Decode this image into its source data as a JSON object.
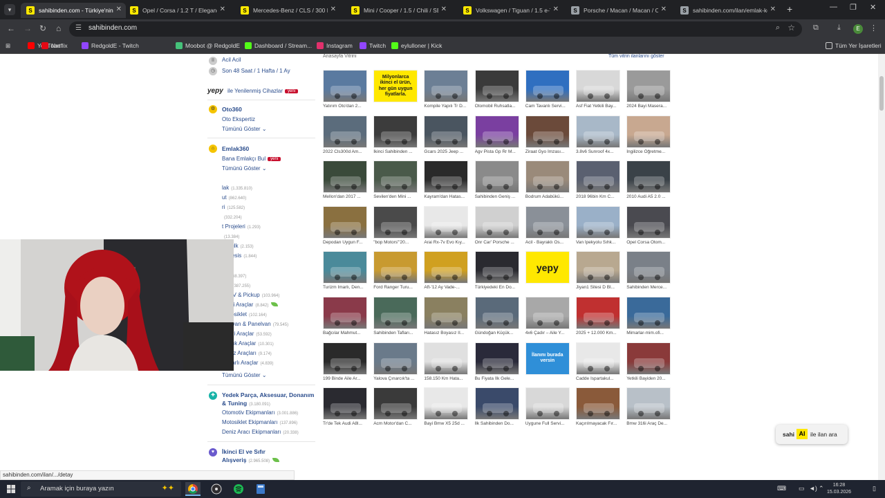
{
  "browser": {
    "tabs": [
      {
        "title": "sahibinden.com - Türkiye'nin Ö",
        "icon_color": "#ffe800",
        "active": true
      },
      {
        "title": "Opel / Corsa / 1.2 T / Elegance",
        "icon_color": "#ffe800"
      },
      {
        "title": "Mercedes-Benz / CLS / 300 D /",
        "icon_color": "#ffe800"
      },
      {
        "title": "Mini / Cooper / 1.5 / Chili / SEV",
        "icon_color": "#ffe800"
      },
      {
        "title": "Volkswagen / Tiguan / 1.5 e-TS",
        "icon_color": "#ffe800"
      },
      {
        "title": "Porsche / Macan / Macan / ON",
        "icon_color": "#9aa0a6"
      },
      {
        "title": "sahibinden.com/ilan/emlak-ko",
        "icon_color": "#9aa0a6"
      }
    ],
    "url": "sahibinden.com",
    "bookmarks": [
      {
        "label": "YouTube",
        "color": "#ff0000"
      },
      {
        "label": "Netflix",
        "color": "#e50914"
      },
      {
        "label": "RedgoldE - Twitch",
        "color": "#9146ff"
      },
      {
        "label": "Moobot @ RedgoldE",
        "color": "#45c27a"
      },
      {
        "label": "Dashboard / Stream...",
        "color": "#53fc18"
      },
      {
        "label": "Instagram",
        "color": "#e1306c"
      },
      {
        "label": "Twitch",
        "color": "#9146ff"
      },
      {
        "label": "eylulloner | Kick",
        "color": "#53fc18"
      }
    ],
    "bookmarks_folder": "Tüm Yer İşaretleri",
    "profile_initial": "E"
  },
  "sidebar": {
    "acil": "Acil Acil",
    "son48": "Son 48 Saat / 1 Hafta / 1 Ay",
    "yepy_logo": "yepy",
    "yepy_label": "ile Yenilenmiş Cihazlar",
    "yeni": "yeni",
    "oto360": "Oto360",
    "oto_ekspertiz": "Oto Ekspertiz",
    "tumunu": "Tümünü Göster",
    "emlak360": "Emlak360",
    "bana_emlakci": "Bana Emlakçı Bul",
    "emlak_items": [
      {
        "label": "lak",
        "count": "(1.335.810)"
      },
      {
        "label": "ut",
        "count": "(862.640)"
      },
      {
        "label": "ri",
        "count": "(125.582)"
      },
      {
        "label": "",
        "count": "(332.204)"
      },
      {
        "label": "t Projeleri",
        "count": "(1.293)"
      },
      {
        "label": "",
        "count": "(13.384)"
      },
      {
        "label": "e Mülk",
        "count": "(2.153)"
      },
      {
        "label": "tik Tesis",
        "count": "(1.844)"
      }
    ],
    "vasita_items": [
      {
        "label": "ta",
        "count": "(768.397)"
      },
      {
        "label": "obil",
        "count": "(387.255)"
      },
      {
        "label": ", SUV & Pickup",
        "count": "(103.964)"
      },
      {
        "label": "ktrikli Araçlar",
        "count": "(8.842)"
      },
      {
        "label": "Motosiklet",
        "count": "(102.164)"
      },
      {
        "label": "Minivan & Panelvan",
        "count": "(79.545)"
      },
      {
        "label": "Ticari Araçlar",
        "count": "(53.592)"
      },
      {
        "label": "Kiralık Araçlar",
        "count": "(10.301)"
      },
      {
        "label": "Deniz Araçları",
        "count": "(9.174)"
      },
      {
        "label": "Hasarlı Araçlar",
        "count": "(4.839)"
      }
    ],
    "yedek_head": "Yedek Parça, Aksesuar, Donanım & Tuning",
    "yedek_count": "(3.180.091)",
    "yedek_items": [
      {
        "label": "Otomotiv Ekipmanları",
        "count": "(3.001.886)"
      },
      {
        "label": "Motosiklet Ekipmanları",
        "count": "(137.896)"
      },
      {
        "label": "Deniz Aracı Ekipmanları",
        "count": "(20.338)"
      }
    ],
    "ikinci_head": "İkinci El ve Sıfır Alışveriş",
    "ikinci_count": "(2.965.508)"
  },
  "vitrin": {
    "title": "Anasayfa Vitrini",
    "all_link": "Tüm vitrin ilanlarını göster",
    "items": [
      {
        "caption": "Yatırım Oto'dan 2...",
        "color": "#5a7aa0"
      },
      {
        "caption": "",
        "color": "#ffe800",
        "ad_text": "Milyonlarca ikinci el ürün, her gün uygun fiyatlarla."
      },
      {
        "caption": "Kompile Yapılı Tr D...",
        "color": "#6c7f95"
      },
      {
        "caption": "Otomobil Ruhsatla...",
        "color": "#3a3a3a"
      },
      {
        "caption": "Cam Tavanlı Servi...",
        "color": "#2f6fc0"
      },
      {
        "caption": "Asf Fiat Yetkili Bay...",
        "color": "#d8d8d8"
      },
      {
        "caption": "2024 Bayi Masera...",
        "color": "#9a9a9a"
      },
      {
        "caption": "2022 Cls300d Am...",
        "color": "#5b6c7c"
      },
      {
        "caption": "İkinci Sahibinden ...",
        "color": "#3c3c3c"
      },
      {
        "caption": "Gcars 2025 Jeep ...",
        "color": "#4a5560"
      },
      {
        "caption": "Agv Pista Gp Rr M...",
        "color": "#7a3fa0"
      },
      {
        "caption": "Ziraat Gyo İmzası...",
        "color": "#6b4a3a"
      },
      {
        "caption": "3.8v6 Sunroof 4x...",
        "color": "#a8b8c8"
      },
      {
        "caption": "İngilizce Öğretme...",
        "color": "#c8a890"
      },
      {
        "caption": "Mellon'dan 2017 ...",
        "color": "#3a4a3a"
      },
      {
        "caption": "Sevilen'den Mini ...",
        "color": "#4a5a4a"
      },
      {
        "caption": "Kayram'dan Hatas...",
        "color": "#2a2a2a"
      },
      {
        "caption": "Sahibinden Geniş ...",
        "color": "#8a8a8a"
      },
      {
        "caption": "Bodrum Adabükü...",
        "color": "#9a8a7a"
      },
      {
        "caption": "2018 96bin Km C...",
        "color": "#5a6070"
      },
      {
        "caption": "2010 Audi A5 2.0 ...",
        "color": "#3a4248"
      },
      {
        "caption": "Depodan Uygun F...",
        "color": "#8a7040"
      },
      {
        "caption": "\"bop Motors\"'20...",
        "color": "#4a4a4a"
      },
      {
        "caption": "Arai Rx-7v Evo Kıy...",
        "color": "#e8e8e8"
      },
      {
        "caption": "Onr Car' Porsche ...",
        "color": "#d0d0d0"
      },
      {
        "caption": "Acil - Bayraklı Os...",
        "color": "#8a9098"
      },
      {
        "caption": "Van İpekyolu Sıhk...",
        "color": "#9ab0c8"
      },
      {
        "caption": "Opel Corsa Otom...",
        "color": "#4a4a50"
      },
      {
        "caption": "Turizm İmarlı, Den...",
        "color": "#4a8a9a"
      },
      {
        "caption": "Ford Ranger Turu...",
        "color": "#c89a30"
      },
      {
        "caption": "Aft-'12 Ay Vade-...",
        "color": "#d0a020"
      },
      {
        "caption": "Türkiyedeki En Do...",
        "color": "#2a2a30"
      },
      {
        "caption": "",
        "color": "#ffe800",
        "ad_text": "yepy"
      },
      {
        "caption": "Jiyan1 Sitesi D Bl...",
        "color": "#b8a890"
      },
      {
        "caption": "Sahibinden Merce...",
        "color": "#7a8088"
      },
      {
        "caption": "Bağcılar Mahmut...",
        "color": "#8a3a4a"
      },
      {
        "caption": "Sahibinden Tafları...",
        "color": "#4a6a5a"
      },
      {
        "caption": "Hatasız Boyasız II...",
        "color": "#8a8060"
      },
      {
        "caption": "Gündoğan Küçük...",
        "color": "#5a6a7a"
      },
      {
        "caption": "4x6 Çadır – Aile Y...",
        "color": "#a8a8a8"
      },
      {
        "caption": "2025 + 12.000 Km...",
        "color": "#c03030"
      },
      {
        "caption": "Mimarlar-mim.ofi...",
        "color": "#3a6a9a"
      },
      {
        "caption": "199 Binde Aile Ar...",
        "color": "#2a2a2a"
      },
      {
        "caption": "Yalova Çınarcık'ta ...",
        "color": "#6a7a8a"
      },
      {
        "caption": "158.150 Km Hata...",
        "color": "#e0e0e0"
      },
      {
        "caption": "Bu Fiyata İlk Gele...",
        "color": "#2a2a3a"
      },
      {
        "caption": "",
        "color": "#2f8fd8",
        "ad_text": "İlanını burada versin"
      },
      {
        "caption": "Cadde Ispartakul...",
        "color": "#e8e8e8"
      },
      {
        "caption": "Yetkili Bayiden 20...",
        "color": "#8a3a3a"
      },
      {
        "caption": "Tr'de Tek Audi A8l...",
        "color": "#2a2a30"
      },
      {
        "caption": "Acm Motor'dan C...",
        "color": "#3a3a3a"
      },
      {
        "caption": "Bayi Bmw X5 25d ...",
        "color": "#e8e8e8"
      },
      {
        "caption": "İlk Sahibinden Do...",
        "color": "#3a4a6a"
      },
      {
        "caption": "Uygune Full Servi...",
        "color": "#d8d8d8"
      },
      {
        "caption": "Kaçırılmayacak Fır...",
        "color": "#8a5a3a"
      },
      {
        "caption": "Bmw 316i Araç De...",
        "color": "#b8c0c8"
      }
    ]
  },
  "ai_button": {
    "left": "sahi",
    "badge": "AI",
    "right": "ile ilan ara"
  },
  "status_link": "sahibinden.com/ilan/.../detay",
  "taskbar": {
    "search_text": "Aramak için buraya yazın",
    "time": "16:28",
    "date": "15.03.2026"
  }
}
